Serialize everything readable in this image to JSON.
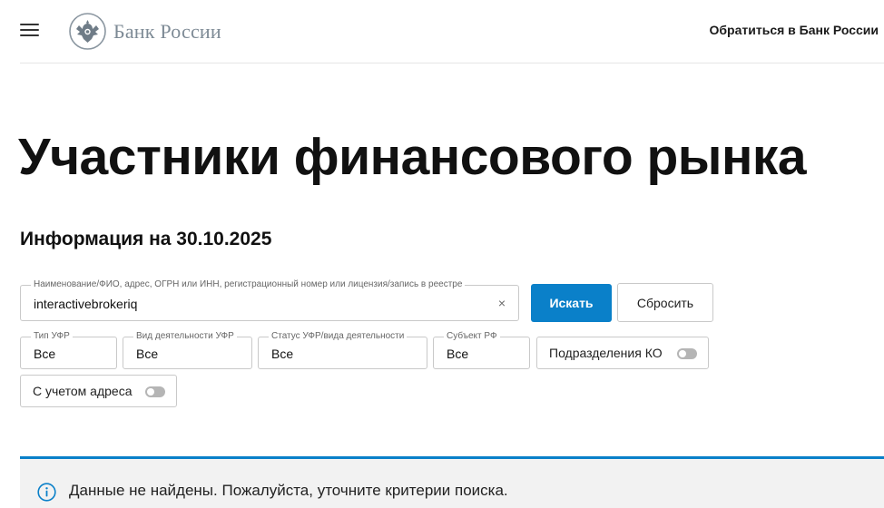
{
  "header": {
    "logo_text": "Банк России",
    "contact_link": "Обратиться в Банк России"
  },
  "page": {
    "title": "Участники финансового рынка",
    "info_date": "Информация на 30.10.2025"
  },
  "search": {
    "label": "Наименование/ФИО, адрес, ОГРН или ИНН, регистрационный номер или лицензия/запись в реестре",
    "value": "interactivebrokeriq",
    "clear_glyph": "×",
    "search_button": "Искать",
    "reset_button": "Сбросить"
  },
  "filters": {
    "type": {
      "label": "Тип УФР",
      "value": "Все"
    },
    "activity": {
      "label": "Вид деятельности УФР",
      "value": "Все"
    },
    "status": {
      "label": "Статус УФР/вида деятельности",
      "value": "Все"
    },
    "region": {
      "label": "Субъект РФ",
      "value": "Все"
    }
  },
  "toggles": {
    "branches": {
      "label": "Подразделения КО",
      "on": false
    },
    "address": {
      "label": "С учетом адреса",
      "on": false
    }
  },
  "notice": {
    "text": "Данные не найдены. Пожалуйста, уточните критерии поиска.",
    "icon": "info-icon"
  },
  "colors": {
    "accent": "#0a80c9",
    "logo_gray": "#7d8a95",
    "notice_bg": "#f2f2f2"
  }
}
